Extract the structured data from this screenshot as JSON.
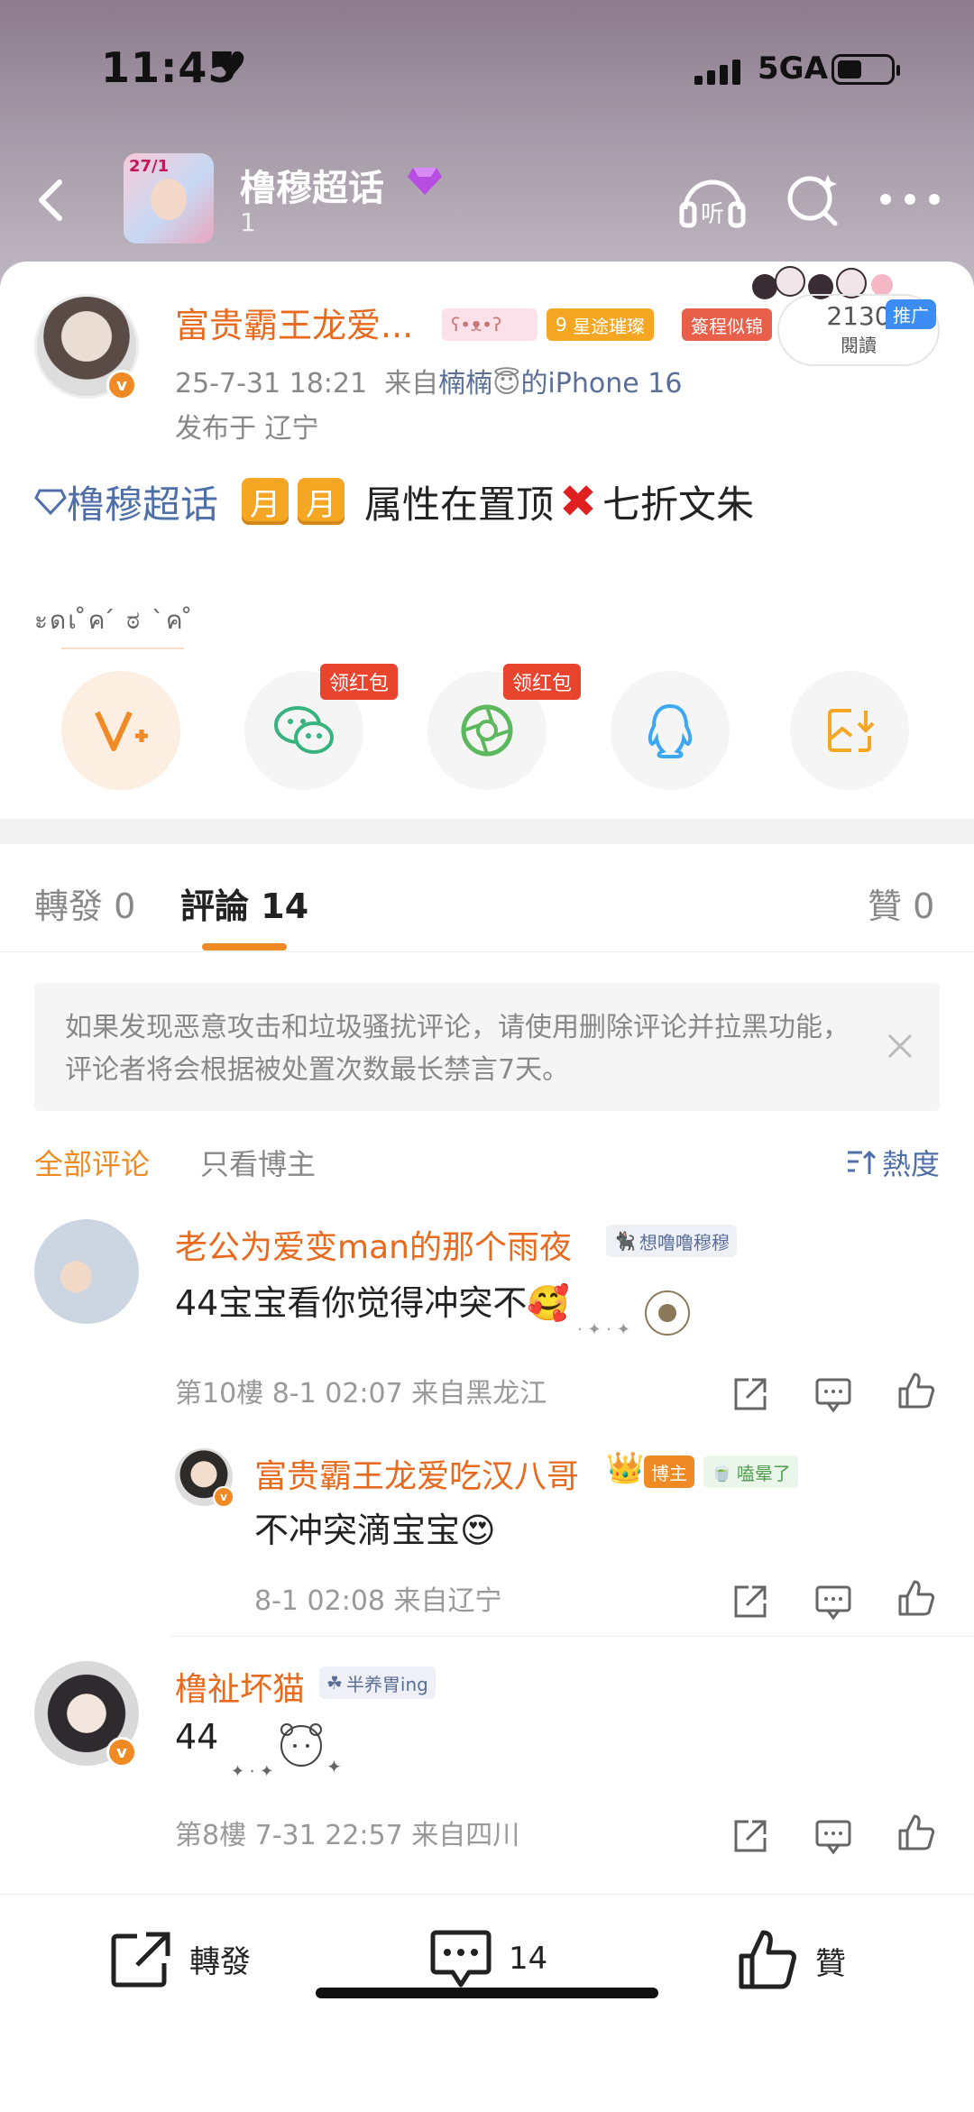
{
  "status_bar": {
    "time": "11:45",
    "network": "5GA"
  },
  "header": {
    "topic_title": "橹穆超话",
    "topic_count": "1",
    "thumb_text": "27/1"
  },
  "post": {
    "author": "富贵霸王龙爱...",
    "tags": [
      "星途璀璨",
      "簽程似锦"
    ],
    "level": "9",
    "timestamp": "25-7-31 18:21",
    "source_prefix": "来自",
    "source_name": "楠楠",
    "source_suffix": "的iPhone 16",
    "location": "发布于 辽宁",
    "read_count": "2130",
    "read_label": "閱讀",
    "promo": "推广",
    "topic_link": "橹穆超话",
    "month_box": "月",
    "content_mid": "属性在置顶",
    "content_end": "七折文朱",
    "deco_text": "ะดเ ̊ค ́ ಠ `ค ̊"
  },
  "share": {
    "redpack_label": "领红包"
  },
  "tabs": {
    "repost_label": "轉發",
    "repost_count": "0",
    "comment_label": "評論",
    "comment_count": "14",
    "like_label": "贊",
    "like_count": "0"
  },
  "notice": {
    "text": "如果发现恶意攻击和垃圾骚扰评论，请使用删除评论并拉黑功能，评论者将会根据被处置次数最长禁言7天。"
  },
  "filter": {
    "all": "全部评论",
    "blogger_only": "只看博主",
    "sort": "熱度"
  },
  "comments": [
    {
      "name": "老公为爱变man的那个雨夜",
      "badge": "想噜噜穆穆",
      "text": "44宝宝看你觉得冲突不",
      "meta": "第10樓 8-1 02:07 来自黑龙江",
      "reply": {
        "name": "富贵霸王龙爱吃汉八哥",
        "role": "博主",
        "badge": "嗑晕了",
        "text": "不冲突滴宝宝",
        "meta": "8-1 02:08 来自辽宁"
      }
    },
    {
      "name": "橹祉坏猫",
      "badge": "半养胃ing",
      "text": "44",
      "meta": "第8樓 7-31 22:57 来自四川"
    }
  ],
  "bottom_bar": {
    "repost": "轉發",
    "comment_count": "14",
    "like": "贊"
  },
  "colors": {
    "accent": "#f08a24",
    "link": "#4f6fa8",
    "author": "#e86a1e",
    "red": "#e8442e"
  }
}
